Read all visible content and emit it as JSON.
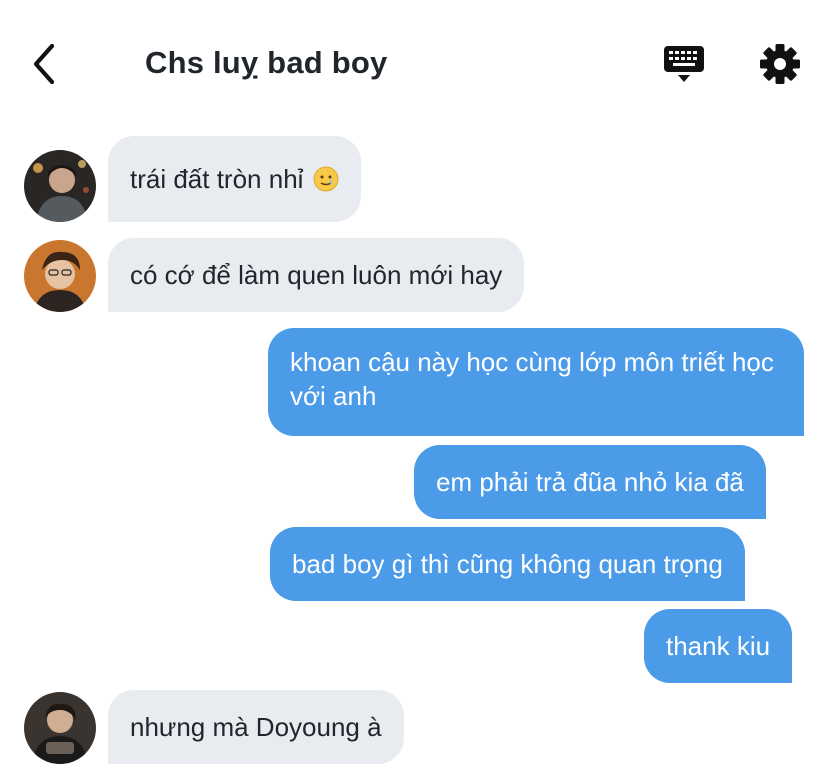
{
  "header": {
    "title": "Chs luỵ bad boy",
    "back_icon": "chevron-left-icon",
    "keyboard_icon": "keyboard-icon",
    "settings_icon": "gear-icon"
  },
  "messages": [
    {
      "direction": "incoming",
      "text": "trái đất tròn nhỉ",
      "emoji": "🥲",
      "avatar": "user-1"
    },
    {
      "direction": "incoming",
      "text": "có cớ để làm quen luôn mới hay",
      "avatar": "user-2"
    },
    {
      "direction": "outgoing",
      "text": "khoan cậu này học cùng lớp môn triết học với anh"
    },
    {
      "direction": "outgoing",
      "text": "em phải trả đũa nhỏ kia đã"
    },
    {
      "direction": "outgoing",
      "text": "bad boy gì thì cũng không quan trọng"
    },
    {
      "direction": "outgoing",
      "text": "thank kiu"
    },
    {
      "direction": "incoming",
      "text": "nhưng mà Doyoung à",
      "avatar": "user-3"
    }
  ],
  "colors": {
    "incoming_bubble": "#e8ecf0",
    "outgoing_bubble": "#4c9be8",
    "title_text": "#20262b"
  }
}
